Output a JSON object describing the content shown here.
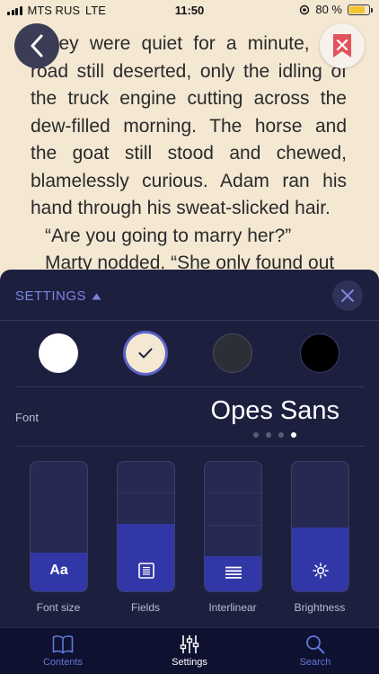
{
  "status_bar": {
    "carrier": "MTS RUS",
    "network": "LTE",
    "time": "11:50",
    "battery": "80 %",
    "battery_level": 0.8
  },
  "book": {
    "paragraph1": "“They were quiet for a minute, the road still deserted, only the idling of the truck engine cutting across the dew-filled morning. The horse and the goat still stood and chewed, blamelessly curious. Adam ran his hand through his sweat-slicked hair.",
    "paragraph2": "“Are you going to marry her?”",
    "paragraph3": "Marty nodded. “She only found out"
  },
  "settings": {
    "title": "SETTINGS",
    "themes": [
      {
        "name": "white",
        "color": "#ffffff"
      },
      {
        "name": "sepia",
        "color": "#f4e8d3"
      },
      {
        "name": "dark-gray",
        "color": "#2d2f36"
      },
      {
        "name": "black",
        "color": "#000000"
      }
    ],
    "selected_theme": "sepia",
    "font_label": "Font",
    "font_name": "Opes Sans",
    "font_page_count": 4,
    "font_page_active": 4,
    "sliders": [
      {
        "label": "Font size",
        "icon": "font-size-icon",
        "level": 0.3
      },
      {
        "label": "Fields",
        "icon": "fields-icon",
        "level": 0.52
      },
      {
        "label": "Interlinear",
        "icon": "interlinear-icon",
        "level": 0.27
      },
      {
        "label": "Brightness",
        "icon": "brightness-icon",
        "level": 0.49
      }
    ]
  },
  "tabs": [
    {
      "label": "Contents",
      "icon": "book-icon",
      "color": "#5e79d6"
    },
    {
      "label": "Settings",
      "icon": "sliders-icon",
      "color": "#ffffff"
    },
    {
      "label": "Search",
      "icon": "search-icon",
      "color": "#5e79d6"
    }
  ],
  "colors": {
    "accent": "#7b86e0",
    "sheet_bg": "#1d1f3f",
    "slider_fill": "#3237a8",
    "page_bg": "#f4e8d3",
    "bookmark_red": "#e2525d"
  }
}
